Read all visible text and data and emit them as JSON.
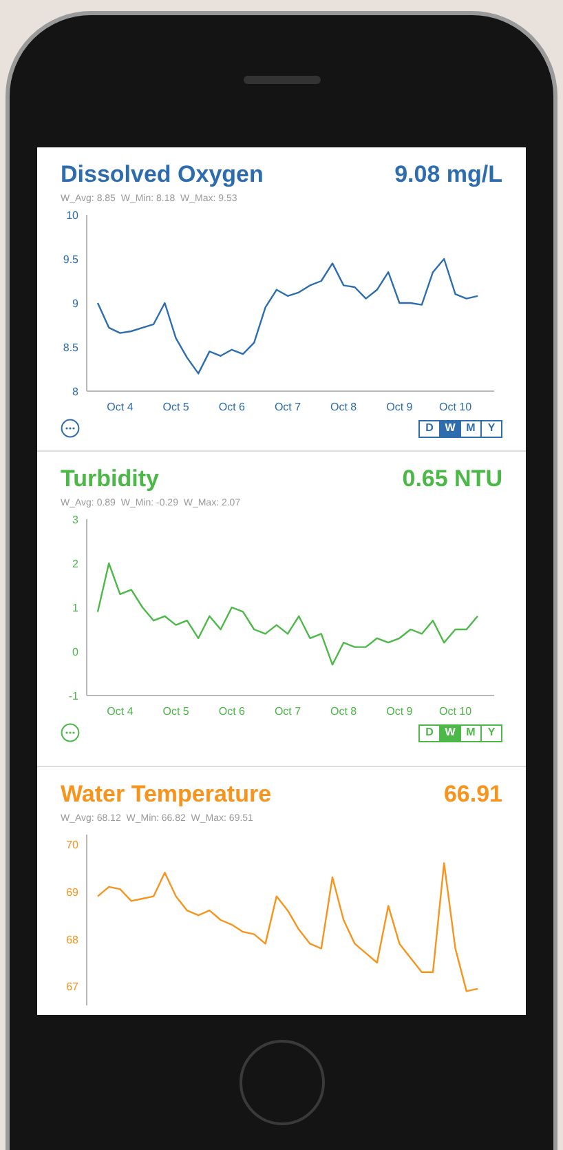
{
  "sections": [
    {
      "title": "Dissolved Oxygen",
      "value": "9.08 mg/L",
      "stats": "W_Avg: 8.85  W_Min: 8.18  W_Max: 9.53",
      "color": "#2d6dad",
      "chart_data": {
        "type": "line",
        "categories": [
          null,
          null,
          "Oct 4",
          null,
          null,
          null,
          null,
          "Oct 5",
          null,
          null,
          null,
          null,
          "Oct 6",
          null,
          null,
          null,
          null,
          "Oct 7",
          null,
          null,
          null,
          null,
          "Oct 8",
          null,
          null,
          null,
          null,
          "Oct 9",
          null,
          null,
          null,
          null,
          "Oct 10",
          null,
          null
        ],
        "values": [
          9.0,
          8.72,
          8.66,
          8.68,
          8.72,
          8.76,
          9.0,
          8.6,
          8.38,
          8.2,
          8.45,
          8.4,
          8.47,
          8.42,
          8.55,
          8.95,
          9.15,
          9.08,
          9.12,
          9.2,
          9.25,
          9.45,
          9.2,
          9.18,
          9.05,
          9.15,
          9.35,
          9.0,
          9.0,
          8.98,
          9.35,
          9.5,
          9.1,
          9.05,
          9.08
        ],
        "ylim": [
          8,
          10
        ],
        "yticks": [
          8,
          8.5,
          9,
          9.5,
          10
        ]
      },
      "range_buttons": [
        {
          "label": "D",
          "selected": false
        },
        {
          "label": "W",
          "selected": true
        },
        {
          "label": "M",
          "selected": false
        },
        {
          "label": "Y",
          "selected": false
        }
      ]
    },
    {
      "title": "Turbidity",
      "value": "0.65 NTU",
      "stats": "W_Avg: 0.89  W_Min: -0.29  W_Max: 2.07",
      "color": "#4cb848",
      "chart_data": {
        "type": "line",
        "categories": [
          null,
          null,
          "Oct 4",
          null,
          null,
          null,
          null,
          "Oct 5",
          null,
          null,
          null,
          null,
          "Oct 6",
          null,
          null,
          null,
          null,
          "Oct 7",
          null,
          null,
          null,
          null,
          "Oct 8",
          null,
          null,
          null,
          null,
          "Oct 9",
          null,
          null,
          null,
          null,
          "Oct 10",
          null,
          null
        ],
        "values": [
          0.9,
          2.0,
          1.3,
          1.4,
          1.0,
          0.7,
          0.8,
          0.6,
          0.7,
          0.3,
          0.8,
          0.5,
          1.0,
          0.9,
          0.5,
          0.4,
          0.6,
          0.4,
          0.8,
          0.3,
          0.4,
          -0.3,
          0.2,
          0.1,
          0.1,
          0.3,
          0.2,
          0.3,
          0.5,
          0.4,
          0.7,
          0.2,
          0.5,
          0.5,
          0.8
        ],
        "ylim": [
          -1,
          3
        ],
        "yticks": [
          -1,
          0,
          1,
          2,
          3
        ]
      },
      "range_buttons": [
        {
          "label": "D",
          "selected": false
        },
        {
          "label": "W",
          "selected": true
        },
        {
          "label": "M",
          "selected": false
        },
        {
          "label": "Y",
          "selected": false
        }
      ]
    },
    {
      "title": "Water Temperature",
      "value": "66.91",
      "stats": "W_Avg: 68.12  W_Min: 66.82  W_Max: 69.51",
      "color": "#f7941d",
      "chart_data": {
        "type": "line",
        "values": [
          68.9,
          69.1,
          69.05,
          68.8,
          68.85,
          68.9,
          69.4,
          68.9,
          68.6,
          68.5,
          68.6,
          68.4,
          68.3,
          68.15,
          68.1,
          67.9,
          68.9,
          68.6,
          68.2,
          67.9,
          67.8,
          69.3,
          68.4,
          67.9,
          67.7,
          67.5,
          68.7,
          67.9,
          67.6,
          67.3,
          67.3,
          69.6,
          67.8,
          66.9,
          66.95
        ],
        "ylim": [
          66.6,
          70.2
        ],
        "yticks": [
          67,
          68,
          69,
          70
        ]
      }
    }
  ]
}
